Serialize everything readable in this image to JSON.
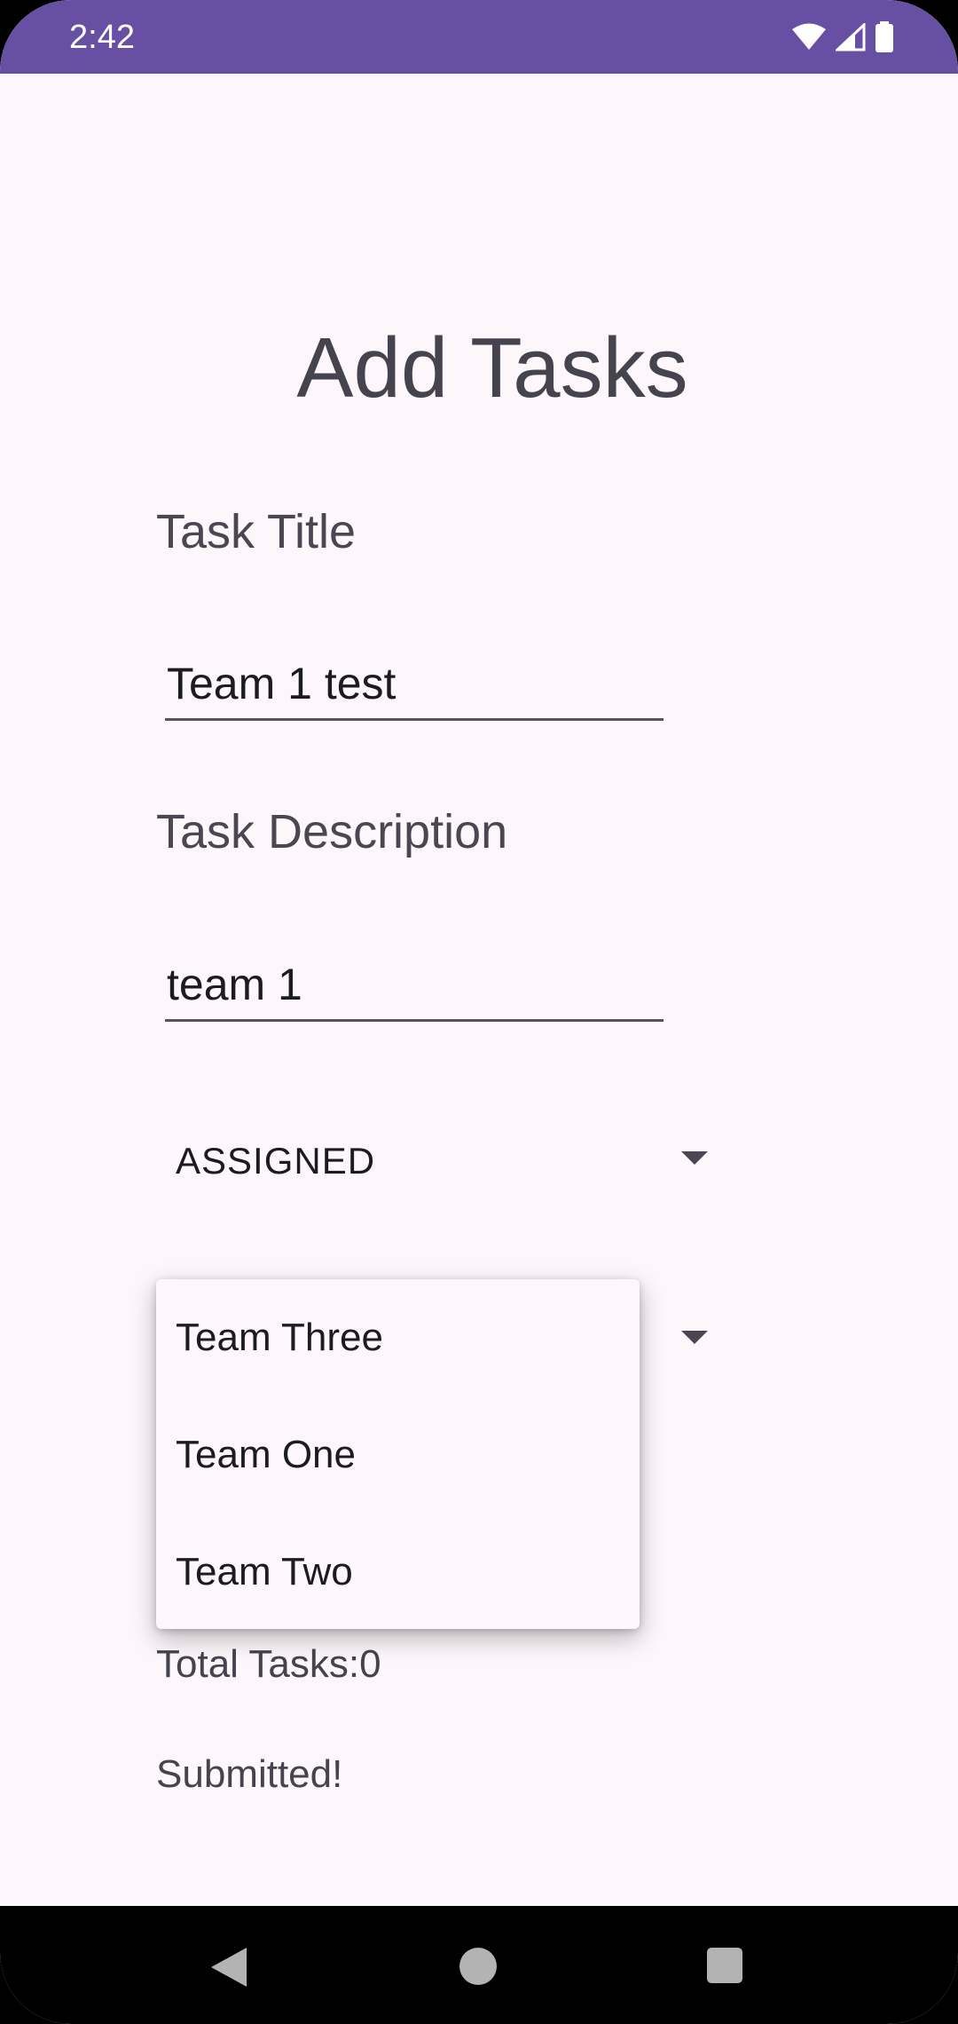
{
  "status_bar": {
    "time": "2:42",
    "icons": [
      "wifi-icon",
      "cellular-signal-icon",
      "battery-icon"
    ],
    "background_color": "#6750a4"
  },
  "page": {
    "title": "Add Tasks"
  },
  "form": {
    "title_label": "Task Title",
    "title_value": "Team 1 test",
    "description_label": "Task Description",
    "description_value": "team 1",
    "state_spinner": {
      "selected": "ASSIGNED"
    },
    "team_spinner": {
      "options": [
        "Team Three",
        "Team One",
        "Team Two"
      ]
    },
    "total_tasks_text": "Total Tasks:0",
    "submitted_text": "Submitted!"
  },
  "nav_bar": {
    "buttons": [
      "back-icon",
      "home-icon",
      "recents-icon"
    ]
  },
  "colors": {
    "accent": "#6750a4",
    "background": "#fdf7fb",
    "text_primary": "#1c1b1f",
    "text_secondary": "#45434d"
  }
}
